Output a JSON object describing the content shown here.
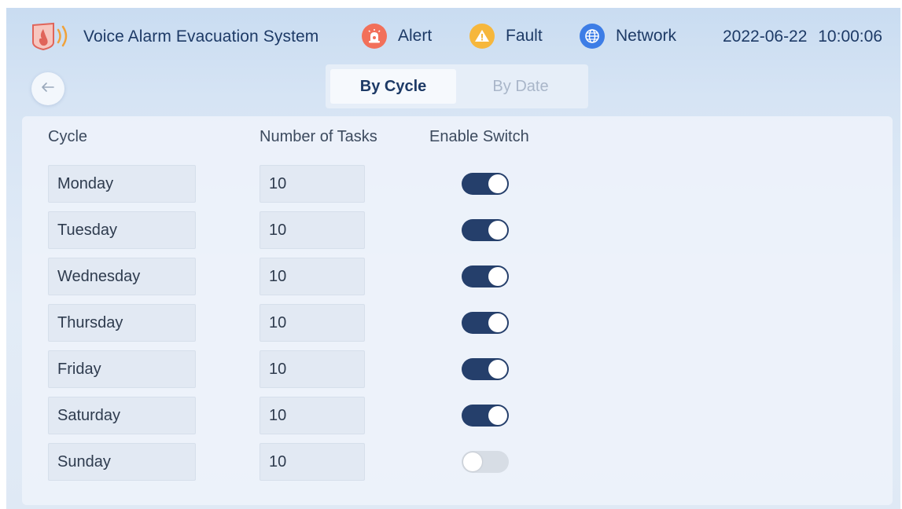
{
  "header": {
    "app_title": "Voice Alarm Evacuation System",
    "logo_icon": "alarm-shield-icon",
    "status_items": [
      {
        "label": "Alert",
        "icon": "siren-icon",
        "color": "#f2705a"
      },
      {
        "label": "Fault",
        "icon": "warning-triangle-icon",
        "color": "#f6b73c"
      },
      {
        "label": "Network",
        "icon": "globe-icon",
        "color": "#3d7de6"
      }
    ],
    "datetime": "2022-06-22 10:00:06"
  },
  "nav": {
    "back_icon": "arrow-left-icon",
    "tabs": [
      {
        "label": "By Cycle",
        "active": true
      },
      {
        "label": "By Date",
        "active": false
      }
    ]
  },
  "table": {
    "columns": [
      "Cycle",
      "Number of Tasks",
      "Enable Switch"
    ],
    "rows": [
      {
        "day": "Monday",
        "tasks": "10",
        "enabled": true
      },
      {
        "day": "Tuesday",
        "tasks": "10",
        "enabled": true
      },
      {
        "day": "Wednesday",
        "tasks": "10",
        "enabled": true
      },
      {
        "day": "Thursday",
        "tasks": "10",
        "enabled": true
      },
      {
        "day": "Friday",
        "tasks": "10",
        "enabled": true
      },
      {
        "day": "Saturday",
        "tasks": "10",
        "enabled": true
      },
      {
        "day": "Sunday",
        "tasks": "10",
        "enabled": false
      }
    ]
  },
  "colors": {
    "toggle_on": "#253f6b",
    "toggle_off": "#d7dde5",
    "title_text": "#1d3a66"
  }
}
